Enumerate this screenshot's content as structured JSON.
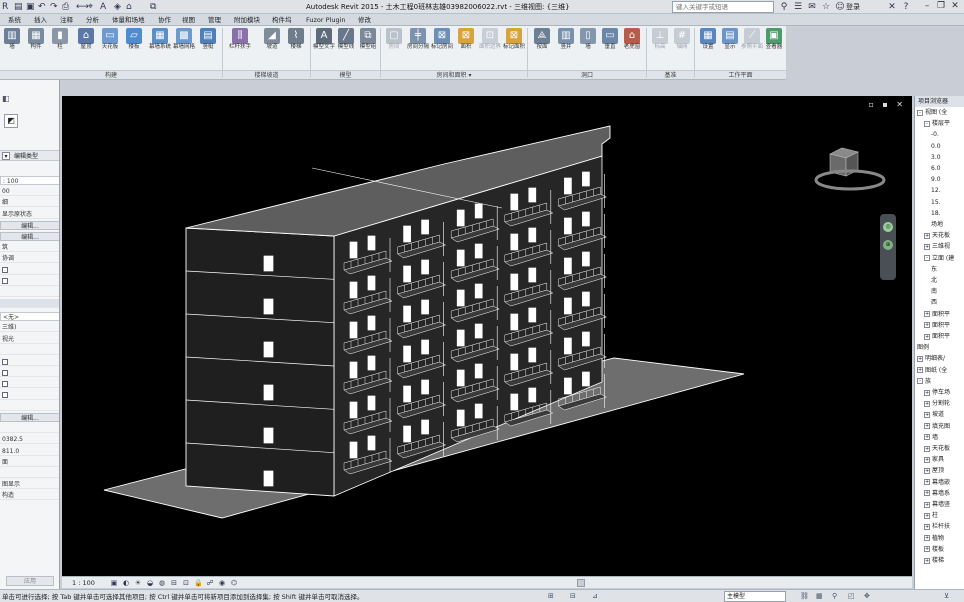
{
  "app": {
    "title": "Autodesk Revit 2015 -   土木工程0班林志雄03982006022.rvt - 三维视图: {三维}",
    "search_placeholder": "键入关键字或短语",
    "login": "登录"
  },
  "tabs": [
    "系统",
    "插入",
    "注释",
    "分析",
    "体量和场地",
    "协作",
    "视图",
    "管理",
    "附加模块",
    "构件坞",
    "Fuzor Plugin",
    "修改"
  ],
  "ribbon": {
    "panels": [
      {
        "label": "构建",
        "tools": [
          "墙",
          "构件",
          "柱",
          "屋顶",
          "天花板",
          "楼板",
          "幕墙系统",
          "幕墙网格",
          "竖梃"
        ]
      },
      {
        "label": "楼梯坡道",
        "tools": [
          "栏杆扶手",
          "坡道",
          "楼梯"
        ]
      },
      {
        "label": "模型",
        "tools": [
          "模型文字",
          "模型线",
          "模型组"
        ]
      },
      {
        "label": "房间和面积 ▾",
        "tools": [
          "房间",
          "房间分隔",
          "标记房间",
          "面积",
          "面积边界",
          "标记面积"
        ]
      },
      {
        "label": "洞口",
        "tools": [
          "按面",
          "竖井",
          "墙",
          "垂直",
          "老虎窗"
        ]
      },
      {
        "label": "基准",
        "tools": [
          "标高",
          "轴网"
        ]
      },
      {
        "label": "工作平面",
        "tools": [
          "设置",
          "显示",
          "参照平面",
          "查看器"
        ]
      }
    ]
  },
  "properties": {
    "edit_type": "编辑类型",
    "rows": [
      {
        "kind": "field",
        "text": ": 100"
      },
      {
        "kind": "text",
        "text": "00"
      },
      {
        "kind": "text",
        "text": "细"
      },
      {
        "kind": "text",
        "text": "显示原状态"
      },
      {
        "kind": "btn",
        "text": "编辑..."
      },
      {
        "kind": "btn",
        "text": "编辑..."
      },
      {
        "kind": "text",
        "text": "筑"
      },
      {
        "kind": "text",
        "text": "协调"
      },
      {
        "kind": "check",
        "text": ""
      },
      {
        "kind": "check",
        "text": ""
      },
      {
        "kind": "text",
        "text": ""
      },
      {
        "kind": "group",
        "text": ""
      },
      {
        "kind": "field",
        "text": "<无>"
      },
      {
        "kind": "text",
        "text": "三维)"
      },
      {
        "kind": "text",
        "text": "视光"
      },
      {
        "kind": "text",
        "text": ""
      },
      {
        "kind": "check",
        "text": ""
      },
      {
        "kind": "check",
        "text": ""
      },
      {
        "kind": "check",
        "text": ""
      },
      {
        "kind": "check",
        "text": ""
      },
      {
        "kind": "text",
        "text": ""
      },
      {
        "kind": "btn",
        "text": "编辑..."
      },
      {
        "kind": "text",
        "text": ""
      },
      {
        "kind": "text",
        "text": "0382.5"
      },
      {
        "kind": "text",
        "text": "811.0"
      },
      {
        "kind": "text",
        "text": "面"
      },
      {
        "kind": "text",
        "text": ""
      },
      {
        "kind": "text",
        "text": "图显示"
      },
      {
        "kind": "text",
        "text": "构造"
      }
    ],
    "apply": "应用"
  },
  "browser": {
    "title": "项目浏览器",
    "items": [
      {
        "indent": 0,
        "toggle": "-",
        "text": "视图 (全"
      },
      {
        "indent": 1,
        "toggle": "-",
        "text": "楼层平"
      },
      {
        "indent": 2,
        "toggle": "",
        "text": "-0."
      },
      {
        "indent": 2,
        "toggle": "",
        "text": "0.0"
      },
      {
        "indent": 2,
        "toggle": "",
        "text": "3.0"
      },
      {
        "indent": 2,
        "toggle": "",
        "text": "6.0"
      },
      {
        "indent": 2,
        "toggle": "",
        "text": "9.0"
      },
      {
        "indent": 2,
        "toggle": "",
        "text": "12."
      },
      {
        "indent": 2,
        "toggle": "",
        "text": "15."
      },
      {
        "indent": 2,
        "toggle": "",
        "text": "18."
      },
      {
        "indent": 2,
        "toggle": "",
        "text": "场地"
      },
      {
        "indent": 1,
        "toggle": "+",
        "text": "天花板"
      },
      {
        "indent": 1,
        "toggle": "+",
        "text": "三维视"
      },
      {
        "indent": 1,
        "toggle": "-",
        "text": "立面 (建"
      },
      {
        "indent": 2,
        "toggle": "",
        "text": "东"
      },
      {
        "indent": 2,
        "toggle": "",
        "text": "北"
      },
      {
        "indent": 2,
        "toggle": "",
        "text": "南"
      },
      {
        "indent": 2,
        "toggle": "",
        "text": "西"
      },
      {
        "indent": 1,
        "toggle": "+",
        "text": "面积平"
      },
      {
        "indent": 1,
        "toggle": "+",
        "text": "面积平"
      },
      {
        "indent": 1,
        "toggle": "+",
        "text": "面积平"
      },
      {
        "indent": 0,
        "toggle": "",
        "text": "图例"
      },
      {
        "indent": 0,
        "toggle": "+",
        "text": "明细表/"
      },
      {
        "indent": 0,
        "toggle": "+",
        "text": "图纸 (全"
      },
      {
        "indent": 0,
        "toggle": "-",
        "text": "族"
      },
      {
        "indent": 1,
        "toggle": "+",
        "text": "停车场"
      },
      {
        "indent": 1,
        "toggle": "+",
        "text": "分割轮"
      },
      {
        "indent": 1,
        "toggle": "+",
        "text": "坡道"
      },
      {
        "indent": 1,
        "toggle": "+",
        "text": "填充图"
      },
      {
        "indent": 1,
        "toggle": "+",
        "text": "墙"
      },
      {
        "indent": 1,
        "toggle": "+",
        "text": "天花板"
      },
      {
        "indent": 1,
        "toggle": "+",
        "text": "家具"
      },
      {
        "indent": 1,
        "toggle": "+",
        "text": "屋顶"
      },
      {
        "indent": 1,
        "toggle": "+",
        "text": "幕墙嵌"
      },
      {
        "indent": 1,
        "toggle": "+",
        "text": "幕墙系"
      },
      {
        "indent": 1,
        "toggle": "+",
        "text": "幕墙竖"
      },
      {
        "indent": 1,
        "toggle": "+",
        "text": "柱"
      },
      {
        "indent": 1,
        "toggle": "+",
        "text": "栏杆扶"
      },
      {
        "indent": 1,
        "toggle": "+",
        "text": "植物"
      },
      {
        "indent": 1,
        "toggle": "+",
        "text": "楼板"
      },
      {
        "indent": 1,
        "toggle": "+",
        "text": "楼梯"
      }
    ]
  },
  "viewbar": {
    "scale": "1 : 100"
  },
  "status": {
    "text": "单击可进行选择; 按 Tab 键并单击可选择其他项目; 按 Ctrl 键并单击可将新项目添加到选择集; 按 Shift 键并单击可取消选择。",
    "model": "主模型"
  },
  "colors": {
    "viewport_bg": "#000000",
    "facade": "#1f1f1f",
    "roof": "#5e5e5e",
    "ground": "#6e6e6e",
    "outline": "#ffffff"
  }
}
